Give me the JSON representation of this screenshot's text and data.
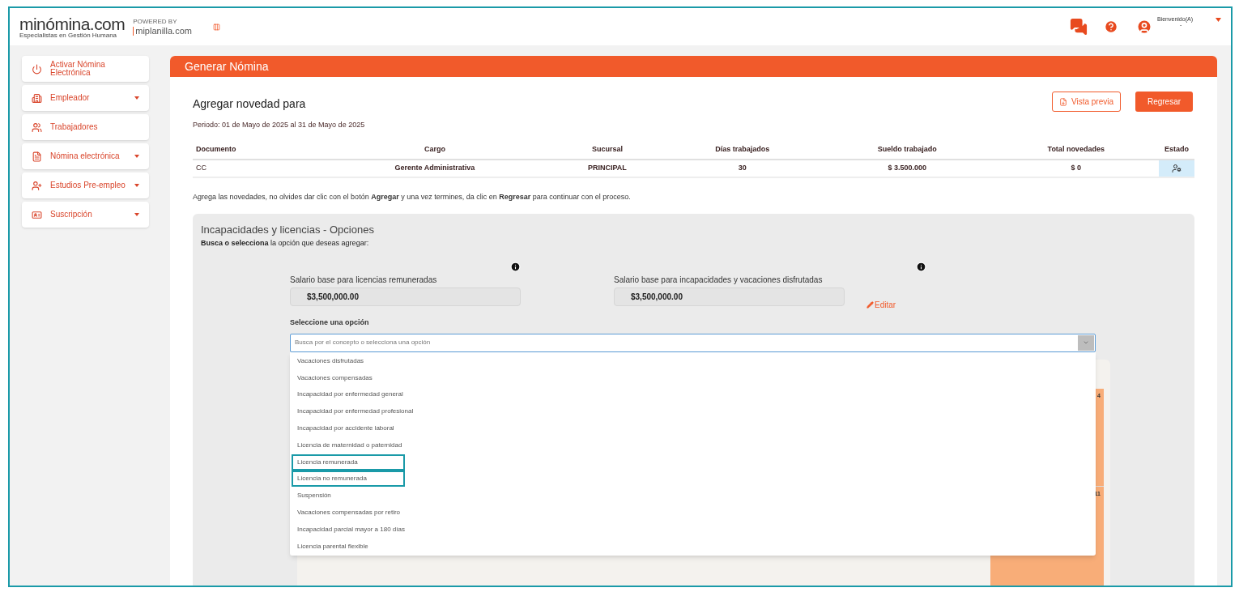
{
  "header": {
    "logo": "minómina.com",
    "tagline": "Especialistas en Gestión Humana",
    "powered_by": "POWERED BY",
    "partner": "miplanilla.com",
    "welcome": "Bienvenido(A)",
    "user_name": "-"
  },
  "sidebar": {
    "items": [
      {
        "label": "Activar Nómina Electrónica",
        "has_caret": false
      },
      {
        "label": "Empleador",
        "has_caret": true
      },
      {
        "label": "Trabajadores",
        "has_caret": false
      },
      {
        "label": "Nómina electrónica",
        "has_caret": true
      },
      {
        "label": "Estudios Pre-empleo",
        "has_caret": true
      },
      {
        "label": "Suscripción",
        "has_caret": true
      }
    ]
  },
  "panel": {
    "title": "Generar Nómina",
    "heading": "Agregar novedad para",
    "period": "Periodo: 01 de Mayo de 2025 al 31 de Mayo de 2025",
    "buttons": [
      {
        "label": "Vista previa",
        "kind": "outline"
      },
      {
        "label": "Regresar",
        "kind": "solid"
      }
    ],
    "table": {
      "columns": [
        "Documento",
        "Cargo",
        "Sucursal",
        "Días trabajados",
        "Sueldo trabajado",
        "Total novedades",
        "Estado"
      ],
      "rows": [
        [
          "CC",
          "Gerente Administrativa",
          "PRINCIPAL",
          "30",
          "$ 3.500.000",
          "$ 0"
        ]
      ]
    },
    "note": "Agrega las novedades, no olvides dar clic con el botón **Agregar** y una vez termines, da clic en **Regresar** para continuar con el proceso."
  },
  "options_section": {
    "title": "Incapacidades y licencias - Opciones",
    "subtitle": "**Busca o selecciona** la opción que deseas agregar:",
    "salary_fields": [
      {
        "label": "Salario base para licencias remuneradas",
        "value": "$3,500,000.00"
      },
      {
        "label": "Salario base para incapacidades y vacaciones disfrutadas",
        "value": "$3,500,000.00"
      }
    ],
    "edit_link": "Editar",
    "select_label": "Seleccione una opción",
    "select_placeholder": "Busca por el concepto o selecciona una opción",
    "options": [
      {
        "label": "Vacaciones disfrutadas",
        "highlighted": false
      },
      {
        "label": "Vacaciones compensadas",
        "highlighted": false
      },
      {
        "label": "Incapacidad por enfermedad general",
        "highlighted": false
      },
      {
        "label": "Incapacidad por enfermedad profesional",
        "highlighted": false
      },
      {
        "label": "Incapacidad por accidente laboral",
        "highlighted": false
      },
      {
        "label": "Licencia de maternidad o paternidad",
        "highlighted": false
      },
      {
        "label": "Licencia remunerada",
        "highlighted": true
      },
      {
        "label": "Licencia no remunerada",
        "highlighted": true
      },
      {
        "label": "Suspensión",
        "highlighted": false
      },
      {
        "label": "Vacaciones compensadas por retiro",
        "highlighted": false
      },
      {
        "label": "Incapacidad parcial mayor a 180 días",
        "highlighted": false
      },
      {
        "label": "Licencia parental flexible",
        "highlighted": false
      }
    ],
    "calendar_days": [
      "4",
      "11"
    ]
  }
}
